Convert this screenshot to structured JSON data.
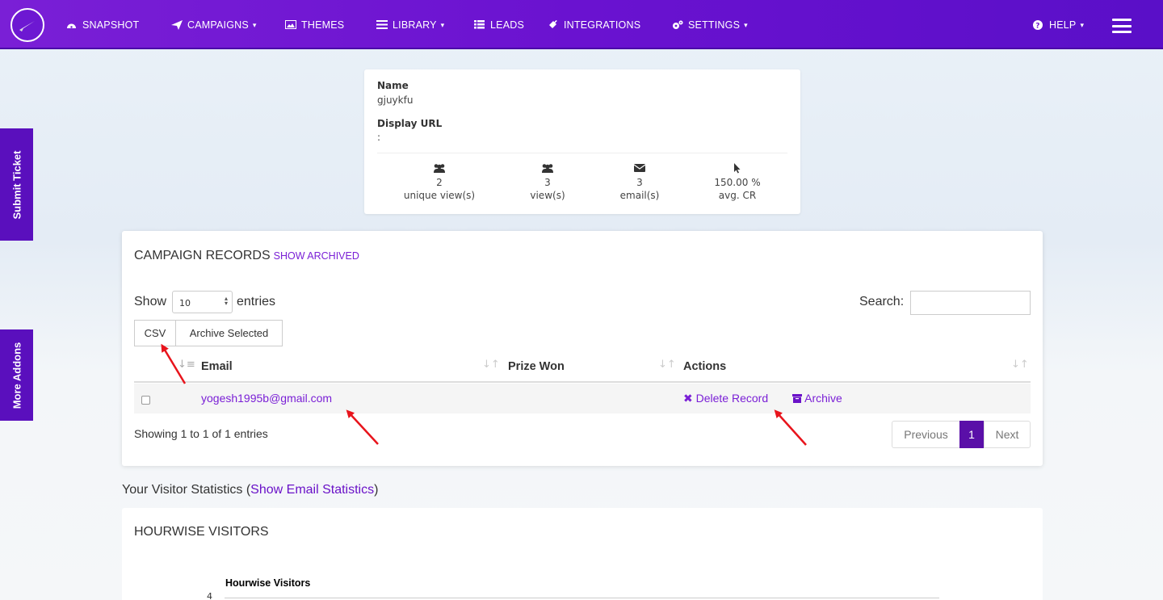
{
  "nav": {
    "items": [
      {
        "label": "SNAPSHOT",
        "icon": "dashboard-icon",
        "caret": false
      },
      {
        "label": "CAMPAIGNS",
        "icon": "paper-plane-icon",
        "caret": true
      },
      {
        "label": "THEMES",
        "icon": "image-icon",
        "caret": false
      },
      {
        "label": "LIBRARY",
        "icon": "book-icon",
        "caret": true
      },
      {
        "label": "LEADS",
        "icon": "list-icon",
        "caret": false
      },
      {
        "label": "INTEGRATIONS",
        "icon": "plug-icon",
        "caret": false
      },
      {
        "label": "SETTINGS",
        "icon": "gears-icon",
        "caret": true
      },
      {
        "label": "HELP",
        "icon": "question-icon",
        "caret": true
      }
    ],
    "caret": "▾"
  },
  "side_tabs": {
    "submit_ticket": "Submit Ticket",
    "more_addons": "More Addons"
  },
  "campaign_info": {
    "name_label": "Name",
    "name_value": "gjuykfu",
    "url_label": "Display URL",
    "url_value": ":",
    "stats": [
      {
        "value": "2",
        "label": "unique view(s)",
        "icon": "users-icon"
      },
      {
        "value": "3",
        "label": "view(s)",
        "icon": "users-icon"
      },
      {
        "value": "3",
        "label": "email(s)",
        "icon": "envelope-icon"
      },
      {
        "value": "150.00 %",
        "label": "avg. CR",
        "icon": "cursor-icon"
      }
    ]
  },
  "records": {
    "title": "CAMPAIGN RECORDS",
    "show_archived": "SHOW ARCHIVED",
    "show_label": "Show",
    "entries_value": "10",
    "entries_label": "entries",
    "search_label": "Search:",
    "search_value": "",
    "csv_button": "CSV",
    "archive_selected_button": "Archive Selected",
    "columns": [
      "Email",
      "Prize Won",
      "Actions"
    ],
    "rows": [
      {
        "email": "yogesh1995b@gmail.com",
        "prize": "",
        "delete_label": "Delete Record",
        "archive_label": "Archive"
      }
    ],
    "showing": "Showing 1 to 1 of 1 entries",
    "pager": {
      "previous": "Previous",
      "current": "1",
      "next": "Next"
    }
  },
  "visitor_stats": {
    "prefix": "Your Visitor Statistics (",
    "link": "Show Email Statistics",
    "suffix": ")"
  },
  "hourwise": {
    "title": "HOURWISE VISITORS",
    "chart_title": "Hourwise Visitors",
    "first_tick": "4"
  },
  "colors": {
    "brand": "#6a12d0",
    "link": "#7a1fd6",
    "annotation": "#e8141c"
  }
}
